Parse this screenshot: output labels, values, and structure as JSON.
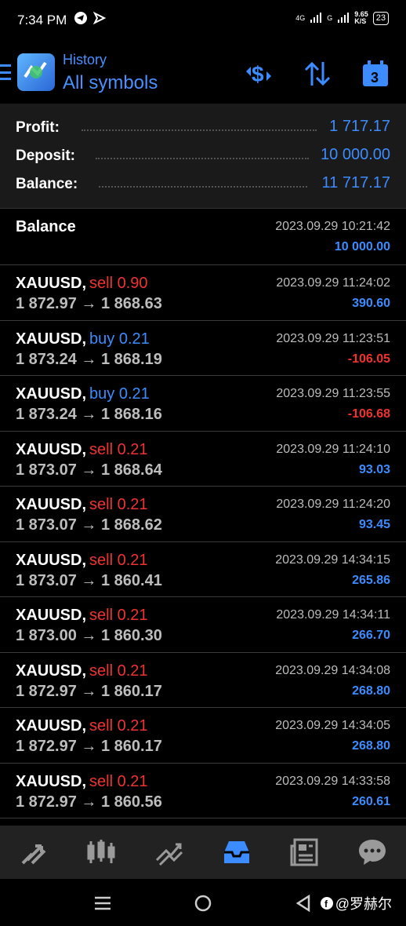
{
  "status": {
    "time": "7:34 PM",
    "net_left": "4G",
    "net_right": "G",
    "speed": "9.65",
    "speed_unit": "K/S",
    "battery": "23"
  },
  "header": {
    "subtitle": "History",
    "title": "All symbols"
  },
  "summary": [
    {
      "label": "Profit:",
      "value": "1 717.17"
    },
    {
      "label": "Deposit:",
      "value": "10 000.00"
    },
    {
      "label": "Balance:",
      "value": "11 717.17"
    }
  ],
  "balance_entry": {
    "label": "Balance",
    "time": "2023.09.29 10:21:42",
    "amount": "10 000.00"
  },
  "trades": [
    {
      "symbol": "XAUUSD,",
      "side": "sell",
      "volume": "0.90",
      "open": "1 872.97",
      "arrow": "→",
      "close": "1 868.63",
      "time": "2023.09.29 11:24:02",
      "profit": "390.60",
      "profit_sign": "pos"
    },
    {
      "symbol": "XAUUSD,",
      "side": "buy",
      "volume": "0.21",
      "open": "1 873.24",
      "arrow": "→",
      "close": "1 868.19",
      "time": "2023.09.29 11:23:51",
      "profit": "-106.05",
      "profit_sign": "neg"
    },
    {
      "symbol": "XAUUSD,",
      "side": "buy",
      "volume": "0.21",
      "open": "1 873.24",
      "arrow": "→",
      "close": "1 868.16",
      "time": "2023.09.29 11:23:55",
      "profit": "-106.68",
      "profit_sign": "neg"
    },
    {
      "symbol": "XAUUSD,",
      "side": "sell",
      "volume": "0.21",
      "open": "1 873.07",
      "arrow": "→",
      "close": "1 868.64",
      "time": "2023.09.29 11:24:10",
      "profit": "93.03",
      "profit_sign": "pos"
    },
    {
      "symbol": "XAUUSD,",
      "side": "sell",
      "volume": "0.21",
      "open": "1 873.07",
      "arrow": "→",
      "close": "1 868.62",
      "time": "2023.09.29 11:24:20",
      "profit": "93.45",
      "profit_sign": "pos"
    },
    {
      "symbol": "XAUUSD,",
      "side": "sell",
      "volume": "0.21",
      "open": "1 873.07",
      "arrow": "→",
      "close": "1 860.41",
      "time": "2023.09.29 14:34:15",
      "profit": "265.86",
      "profit_sign": "pos"
    },
    {
      "symbol": "XAUUSD,",
      "side": "sell",
      "volume": "0.21",
      "open": "1 873.00",
      "arrow": "→",
      "close": "1 860.30",
      "time": "2023.09.29 14:34:11",
      "profit": "266.70",
      "profit_sign": "pos"
    },
    {
      "symbol": "XAUUSD,",
      "side": "sell",
      "volume": "0.21",
      "open": "1 872.97",
      "arrow": "→",
      "close": "1 860.17",
      "time": "2023.09.29 14:34:08",
      "profit": "268.80",
      "profit_sign": "pos"
    },
    {
      "symbol": "XAUUSD,",
      "side": "sell",
      "volume": "0.21",
      "open": "1 872.97",
      "arrow": "→",
      "close": "1 860.17",
      "time": "2023.09.29 14:34:05",
      "profit": "268.80",
      "profit_sign": "pos"
    },
    {
      "symbol": "XAUUSD,",
      "side": "sell",
      "volume": "0.21",
      "open": "1 872.97",
      "arrow": "→",
      "close": "1 860.56",
      "time": "2023.09.29 14:33:58",
      "profit": "260.61",
      "profit_sign": "pos"
    }
  ],
  "nav": [
    {
      "name": "quotes-icon"
    },
    {
      "name": "chart-icon"
    },
    {
      "name": "trade-icon"
    },
    {
      "name": "history-icon",
      "active": true
    },
    {
      "name": "news-icon"
    },
    {
      "name": "chat-icon"
    }
  ],
  "watermark": "@罗赫尔",
  "colors": {
    "accent": "#3d8cff",
    "loss": "#f03232",
    "summary_bg": "#1a1a1a",
    "nav_bg": "#222222"
  }
}
